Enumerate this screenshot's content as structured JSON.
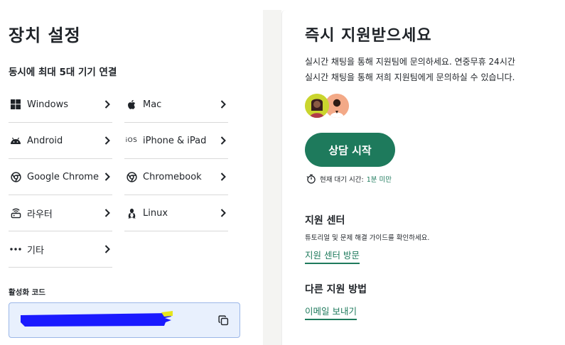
{
  "left": {
    "title": "장치 설정",
    "subtitle": "동시에 최대 5대 기기 연결",
    "devices_left": [
      {
        "label": "Windows",
        "icon": "windows-icon"
      },
      {
        "label": "Android",
        "icon": "android-icon"
      },
      {
        "label": "Google Chrome",
        "icon": "chrome-icon"
      },
      {
        "label": "라우터",
        "icon": "router-icon"
      },
      {
        "label": "기타",
        "icon": "more-icon"
      }
    ],
    "devices_right": [
      {
        "label": "Mac",
        "icon": "apple-icon"
      },
      {
        "label": "iPhone & iPad",
        "icon": "ios-icon",
        "icon_text": "iOS"
      },
      {
        "label": "Chromebook",
        "icon": "chrome-icon"
      },
      {
        "label": "Linux",
        "icon": "linux-icon"
      }
    ],
    "activation": {
      "label": "활성화 코드"
    }
  },
  "right": {
    "title": "즉시 지원받으세요",
    "desc1": "실시간 채팅을 통해 지원팀에 문의하세요. 연중무휴 24시간",
    "desc2": "실시간 채팅을 통해 저희 지원팀에게 문의하실 수 있습니다.",
    "chat_button": "상담 시작",
    "wait_label": "현재 대기 시간:",
    "wait_value": "1분 미만",
    "support_center": {
      "heading": "지원 센터",
      "text": "튜토리얼 및 문제 해결 가이드를 확인하세요.",
      "link": "지원 센터 방문"
    },
    "other": {
      "heading": "다른 지원 방법",
      "link": "이메일 보내기"
    }
  },
  "colors": {
    "accent": "#1e7a5c",
    "input_bg": "#e8f0fd",
    "redaction": "#1a1aff"
  }
}
